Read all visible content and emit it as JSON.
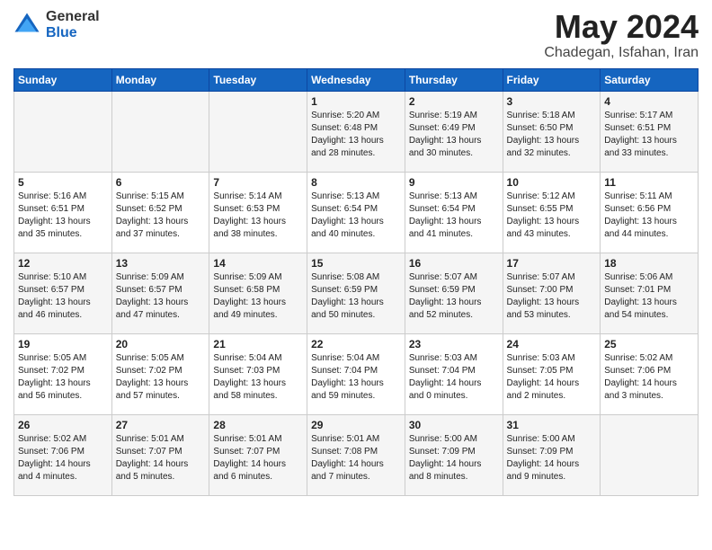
{
  "logo": {
    "general": "General",
    "blue": "Blue"
  },
  "title": "May 2024",
  "subtitle": "Chadegan, Isfahan, Iran",
  "days_of_week": [
    "Sunday",
    "Monday",
    "Tuesday",
    "Wednesday",
    "Thursday",
    "Friday",
    "Saturday"
  ],
  "weeks": [
    [
      {
        "day": "",
        "info": ""
      },
      {
        "day": "",
        "info": ""
      },
      {
        "day": "",
        "info": ""
      },
      {
        "day": "1",
        "info": "Sunrise: 5:20 AM\nSunset: 6:48 PM\nDaylight: 13 hours\nand 28 minutes."
      },
      {
        "day": "2",
        "info": "Sunrise: 5:19 AM\nSunset: 6:49 PM\nDaylight: 13 hours\nand 30 minutes."
      },
      {
        "day": "3",
        "info": "Sunrise: 5:18 AM\nSunset: 6:50 PM\nDaylight: 13 hours\nand 32 minutes."
      },
      {
        "day": "4",
        "info": "Sunrise: 5:17 AM\nSunset: 6:51 PM\nDaylight: 13 hours\nand 33 minutes."
      }
    ],
    [
      {
        "day": "5",
        "info": "Sunrise: 5:16 AM\nSunset: 6:51 PM\nDaylight: 13 hours\nand 35 minutes."
      },
      {
        "day": "6",
        "info": "Sunrise: 5:15 AM\nSunset: 6:52 PM\nDaylight: 13 hours\nand 37 minutes."
      },
      {
        "day": "7",
        "info": "Sunrise: 5:14 AM\nSunset: 6:53 PM\nDaylight: 13 hours\nand 38 minutes."
      },
      {
        "day": "8",
        "info": "Sunrise: 5:13 AM\nSunset: 6:54 PM\nDaylight: 13 hours\nand 40 minutes."
      },
      {
        "day": "9",
        "info": "Sunrise: 5:13 AM\nSunset: 6:54 PM\nDaylight: 13 hours\nand 41 minutes."
      },
      {
        "day": "10",
        "info": "Sunrise: 5:12 AM\nSunset: 6:55 PM\nDaylight: 13 hours\nand 43 minutes."
      },
      {
        "day": "11",
        "info": "Sunrise: 5:11 AM\nSunset: 6:56 PM\nDaylight: 13 hours\nand 44 minutes."
      }
    ],
    [
      {
        "day": "12",
        "info": "Sunrise: 5:10 AM\nSunset: 6:57 PM\nDaylight: 13 hours\nand 46 minutes."
      },
      {
        "day": "13",
        "info": "Sunrise: 5:09 AM\nSunset: 6:57 PM\nDaylight: 13 hours\nand 47 minutes."
      },
      {
        "day": "14",
        "info": "Sunrise: 5:09 AM\nSunset: 6:58 PM\nDaylight: 13 hours\nand 49 minutes."
      },
      {
        "day": "15",
        "info": "Sunrise: 5:08 AM\nSunset: 6:59 PM\nDaylight: 13 hours\nand 50 minutes."
      },
      {
        "day": "16",
        "info": "Sunrise: 5:07 AM\nSunset: 6:59 PM\nDaylight: 13 hours\nand 52 minutes."
      },
      {
        "day": "17",
        "info": "Sunrise: 5:07 AM\nSunset: 7:00 PM\nDaylight: 13 hours\nand 53 minutes."
      },
      {
        "day": "18",
        "info": "Sunrise: 5:06 AM\nSunset: 7:01 PM\nDaylight: 13 hours\nand 54 minutes."
      }
    ],
    [
      {
        "day": "19",
        "info": "Sunrise: 5:05 AM\nSunset: 7:02 PM\nDaylight: 13 hours\nand 56 minutes."
      },
      {
        "day": "20",
        "info": "Sunrise: 5:05 AM\nSunset: 7:02 PM\nDaylight: 13 hours\nand 57 minutes."
      },
      {
        "day": "21",
        "info": "Sunrise: 5:04 AM\nSunset: 7:03 PM\nDaylight: 13 hours\nand 58 minutes."
      },
      {
        "day": "22",
        "info": "Sunrise: 5:04 AM\nSunset: 7:04 PM\nDaylight: 13 hours\nand 59 minutes."
      },
      {
        "day": "23",
        "info": "Sunrise: 5:03 AM\nSunset: 7:04 PM\nDaylight: 14 hours\nand 0 minutes."
      },
      {
        "day": "24",
        "info": "Sunrise: 5:03 AM\nSunset: 7:05 PM\nDaylight: 14 hours\nand 2 minutes."
      },
      {
        "day": "25",
        "info": "Sunrise: 5:02 AM\nSunset: 7:06 PM\nDaylight: 14 hours\nand 3 minutes."
      }
    ],
    [
      {
        "day": "26",
        "info": "Sunrise: 5:02 AM\nSunset: 7:06 PM\nDaylight: 14 hours\nand 4 minutes."
      },
      {
        "day": "27",
        "info": "Sunrise: 5:01 AM\nSunset: 7:07 PM\nDaylight: 14 hours\nand 5 minutes."
      },
      {
        "day": "28",
        "info": "Sunrise: 5:01 AM\nSunset: 7:07 PM\nDaylight: 14 hours\nand 6 minutes."
      },
      {
        "day": "29",
        "info": "Sunrise: 5:01 AM\nSunset: 7:08 PM\nDaylight: 14 hours\nand 7 minutes."
      },
      {
        "day": "30",
        "info": "Sunrise: 5:00 AM\nSunset: 7:09 PM\nDaylight: 14 hours\nand 8 minutes."
      },
      {
        "day": "31",
        "info": "Sunrise: 5:00 AM\nSunset: 7:09 PM\nDaylight: 14 hours\nand 9 minutes."
      },
      {
        "day": "",
        "info": ""
      }
    ]
  ]
}
